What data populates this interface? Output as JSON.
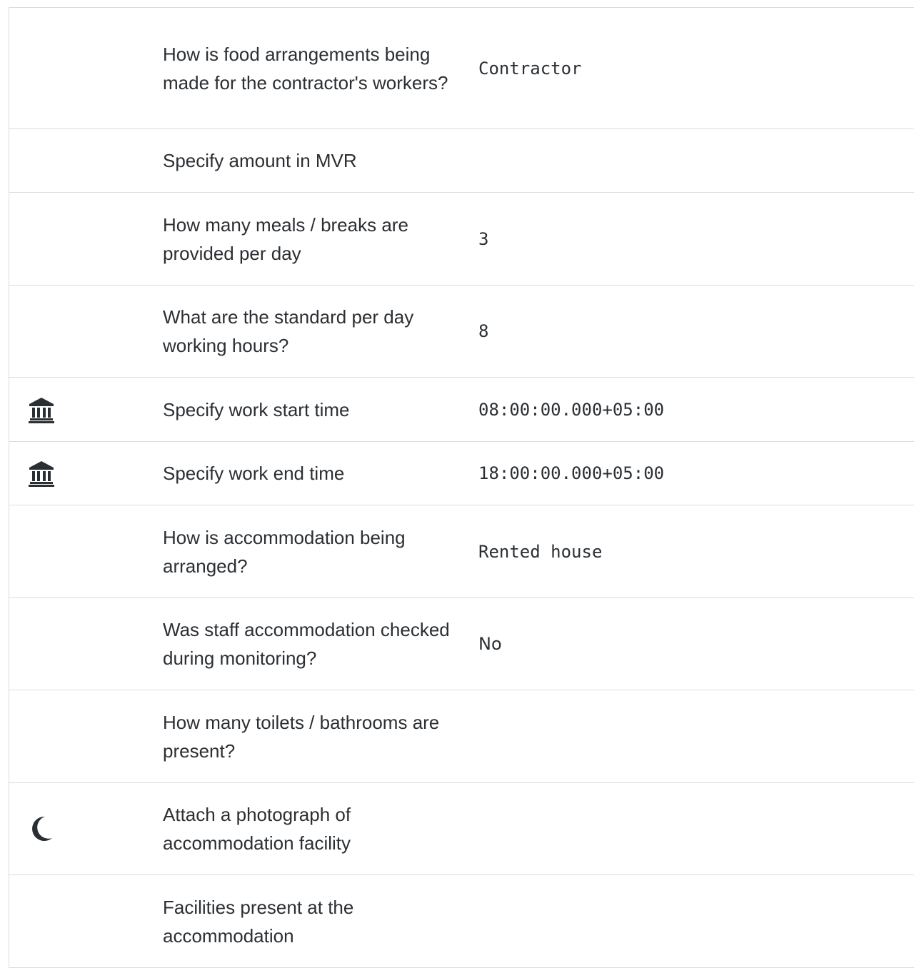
{
  "rows": [
    {
      "question": "How is food arrangements being made for the contractor's workers?",
      "answer": "Contractor",
      "icon": ""
    },
    {
      "question": "Specify amount in MVR",
      "answer": "",
      "icon": ""
    },
    {
      "question": "How many meals / breaks are provided per day",
      "answer": "3",
      "icon": ""
    },
    {
      "question": "What are the standard per day working hours?",
      "answer": "8",
      "icon": ""
    },
    {
      "question": "Specify work start time",
      "answer": "08:00:00.000+05:00",
      "icon": "bank-icon"
    },
    {
      "question": "Specify work end time",
      "answer": "18:00:00.000+05:00",
      "icon": "bank-icon"
    },
    {
      "question": "How is accommodation being arranged?",
      "answer": "Rented house",
      "icon": ""
    },
    {
      "question": "Was staff accommodation checked during monitoring?",
      "answer": "No",
      "icon": ""
    },
    {
      "question": "How many toilets / bathrooms are present?",
      "answer": "",
      "icon": ""
    },
    {
      "question": "Attach a photograph of accommodation facility",
      "answer": "",
      "icon": "moon-icon"
    },
    {
      "question": "Facilities present at the accommodation",
      "answer": "",
      "icon": ""
    }
  ]
}
